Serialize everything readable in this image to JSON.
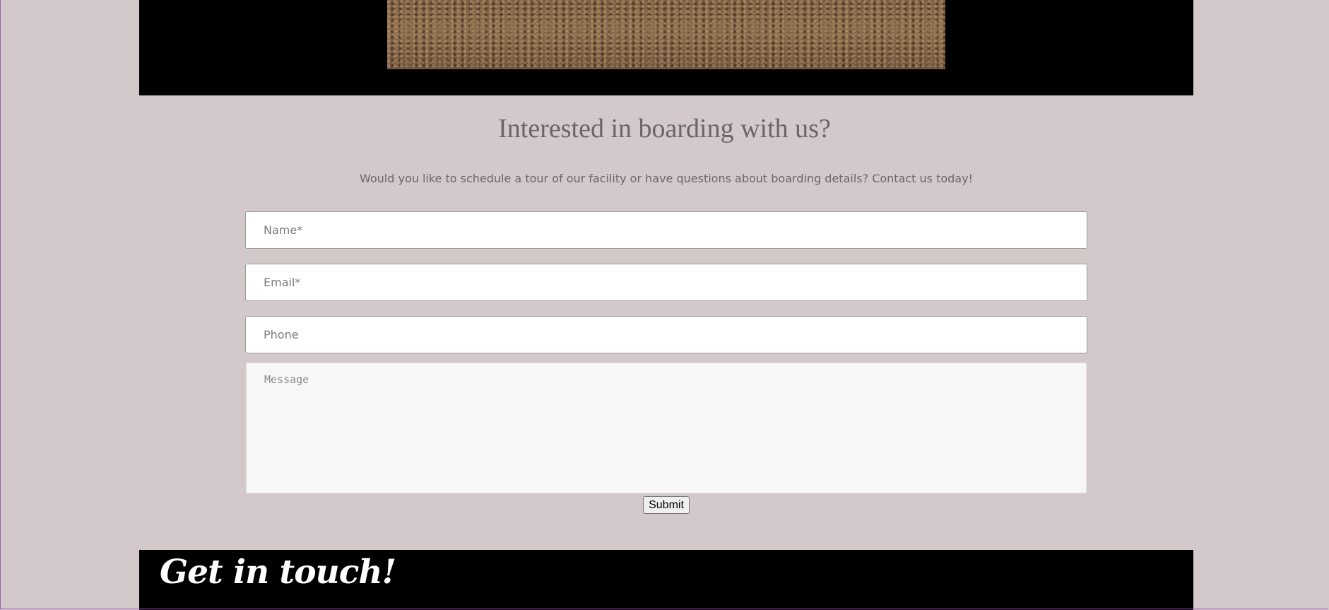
{
  "contact": {
    "title": "Interested in boarding with us?",
    "subtitle": "Would you like to schedule a tour of our facility or have questions about boarding details? Contact us today!",
    "fields": {
      "name_placeholder": "Name*",
      "email_placeholder": "Email*",
      "phone_placeholder": "Phone",
      "message_placeholder": "Message"
    },
    "submit_label": "Submit"
  },
  "footer": {
    "title": "Get in touch!"
  },
  "colors": {
    "page_background": "#d3c9ca",
    "band_background": "#000000",
    "heading_text": "#6a6667"
  }
}
